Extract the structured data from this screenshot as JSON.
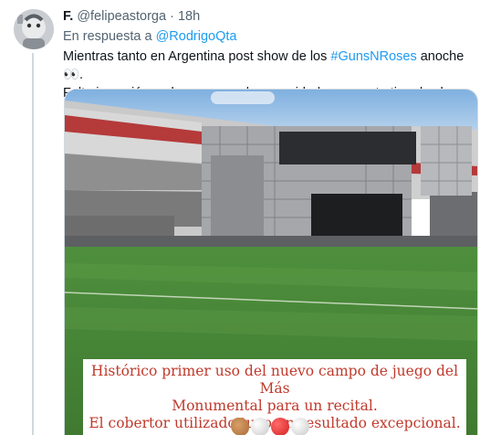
{
  "tweet": {
    "display_name": "F.",
    "handle": "@felipeastorga",
    "separator": "·",
    "time": "18h",
    "reply_prefix": "En respuesta a",
    "reply_to": "@RodrigoQta",
    "text_part1": "Mientras tanto en Argentina post show de los ",
    "hashtag": "#GunsNRoses",
    "text_part2": " anoche 👀.",
    "text_line2": "Falta inversión en buenas canchas y cuidado para este tipo de show."
  },
  "image": {
    "caption_lines": [
      "Histórico primer uso del nuevo campo de juego del Más",
      "Monumental para un recital.",
      "El cobertor utilizado tuvo un resultado excepcional."
    ],
    "emoji_names": [
      "clap-emoji",
      "white-circle-emoji",
      "red-circle-emoji",
      "white-circle-emoji"
    ]
  },
  "colors": {
    "accent": "#1d9bf0",
    "caption_red": "#c0392b",
    "grass": "#4f8d3c",
    "sky": "#9fc3e6"
  }
}
